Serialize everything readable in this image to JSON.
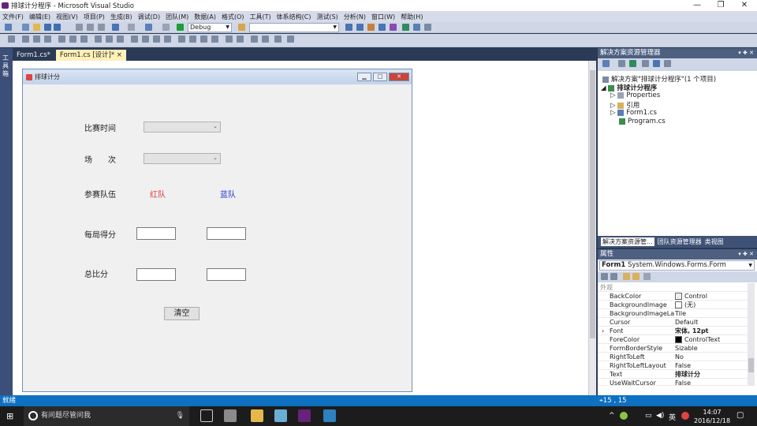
{
  "window": {
    "title": "排球计分程序 - Microsoft Visual Studio",
    "min": "—",
    "max": "❐",
    "close": "✕"
  },
  "menu": [
    "文件(F)",
    "编辑(E)",
    "视图(V)",
    "项目(P)",
    "生成(B)",
    "调试(D)",
    "团队(M)",
    "数据(A)",
    "格式(O)",
    "工具(T)",
    "体系结构(C)",
    "测试(S)",
    "分析(N)",
    "窗口(W)",
    "帮助(H)"
  ],
  "toolbar": {
    "config": "Debug"
  },
  "left_tab": "工具箱",
  "tabs": [
    {
      "label": "Form1.cs*"
    },
    {
      "label": "Form1.cs [设计]*"
    }
  ],
  "tab_close": "×",
  "form": {
    "caption": "排球计分",
    "match_time_label": "比赛时间",
    "round_label": "场　　次",
    "teams_label": "参赛队伍",
    "red_team": "红队",
    "blue_team": "蓝队",
    "per_set_label": "每局得分",
    "total_label": "总比分",
    "clear_button": "清空"
  },
  "colors": {
    "red_team": "#e53935",
    "blue_team": "#1e3ad6"
  },
  "solution": {
    "title": "解决方案资源管理器",
    "pin": "▾ ✚ ✕",
    "items": [
      "解决方案\"排球计分程序\"(1 个项目)",
      "排球计分程序",
      "Properties",
      "引用",
      "Form1.cs",
      "Program.cs"
    ],
    "bottom_tabs": [
      "解决方案资源管...",
      "团队资源管理器",
      "类视图"
    ]
  },
  "properties": {
    "title": "属性",
    "pin": "▾ ✚ ✕",
    "selector_name": "Form1",
    "selector_type": "System.Windows.Forms.Form",
    "category": "外观",
    "rows": [
      {
        "k": "BackColor",
        "v": "Control"
      },
      {
        "k": "BackgroundImage",
        "v": "(无)"
      },
      {
        "k": "BackgroundImageLayout",
        "v": "Tile"
      },
      {
        "k": "Cursor",
        "v": "Default"
      },
      {
        "k": "Font",
        "v": "宋体, 12pt"
      },
      {
        "k": "ForeColor",
        "v": "ControlText"
      },
      {
        "k": "FormBorderStyle",
        "v": "Sizable"
      },
      {
        "k": "RightToLeft",
        "v": "No"
      },
      {
        "k": "RightToLeftLayout",
        "v": "False"
      },
      {
        "k": "Text",
        "v": "排球计分"
      },
      {
        "k": "UseWaitCursor",
        "v": "False"
      }
    ]
  },
  "status": {
    "text": "就绪",
    "position": "15 , 15"
  },
  "taskbar": {
    "search_placeholder": "有问题尽管问我",
    "ime": "英",
    "time": "14:07",
    "date": "2016/12/18",
    "start_icon": "⊞"
  }
}
